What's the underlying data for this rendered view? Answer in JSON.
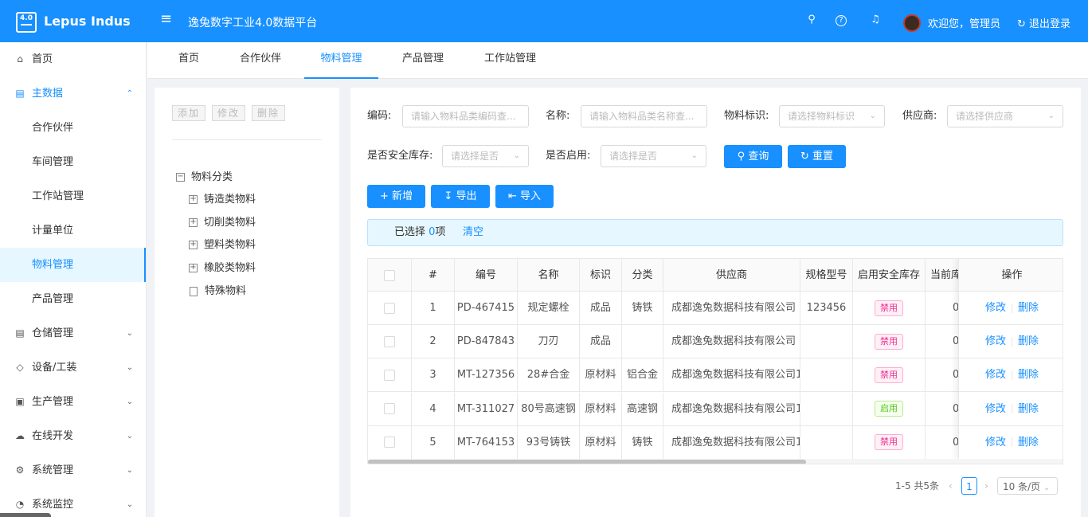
{
  "app": {
    "logo_badge": "4.0",
    "name": "Lepus Indus",
    "system_title": "逸兔数字工业4.0数据平台"
  },
  "topbar": {
    "welcome": "欢迎您，管理员",
    "logout": "退出登录"
  },
  "sidebar": {
    "items": [
      {
        "label": "首页",
        "icon": "home-icon"
      },
      {
        "label": "主数据",
        "icon": "list-icon",
        "expanded": true
      },
      {
        "label": "合作伙伴"
      },
      {
        "label": "车间管理"
      },
      {
        "label": "工作站管理"
      },
      {
        "label": "计量单位"
      },
      {
        "label": "物料管理",
        "active": true
      },
      {
        "label": "产品管理"
      },
      {
        "label": "仓储管理",
        "icon": "warehouse-icon"
      },
      {
        "label": "设备/工装",
        "icon": "tag-icon"
      },
      {
        "label": "生产管理",
        "icon": "document-icon"
      },
      {
        "label": "在线开发",
        "icon": "cloud-icon"
      },
      {
        "label": "系统管理",
        "icon": "gear-icon"
      },
      {
        "label": "系统监控",
        "icon": "dashboard-icon"
      }
    ]
  },
  "tabs": [
    "首页",
    "合作伙伴",
    "物料管理",
    "产品管理",
    "工作站管理"
  ],
  "active_tab": "物料管理",
  "tree": {
    "buttons": {
      "add": "添加",
      "edit": "修改",
      "delete": "删除"
    },
    "root": "物料分类",
    "children": [
      "铸造类物料",
      "切削类物料",
      "塑料类物料",
      "橡胶类物料",
      "特殊物料"
    ]
  },
  "filters": {
    "code_label": "编码:",
    "code_placeholder": "请输入物料品类编码查...",
    "name_label": "名称:",
    "name_placeholder": "请输入物料品类名称查...",
    "mark_label": "物料标识:",
    "mark_placeholder": "请选择物料标识",
    "supplier_label": "供应商:",
    "supplier_placeholder": "请选择供应商",
    "safety_label": "是否安全库存:",
    "safety_placeholder": "请选择是否",
    "enabled_label": "是否启用:",
    "enabled_placeholder": "请选择是否",
    "query": "查询",
    "reset": "重置"
  },
  "actions": {
    "add": "新增",
    "export": "导出",
    "import": "导入"
  },
  "selection": {
    "prefix": "已选择 ",
    "count": "0",
    "suffix": "项",
    "clear": "清空"
  },
  "table": {
    "headers": [
      "#",
      "编号",
      "名称",
      "标识",
      "分类",
      "供应商",
      "规格型号",
      "启用安全库存",
      "当前库存",
      "操作"
    ],
    "rows": [
      {
        "no": "1",
        "code": "PD-467415",
        "name": "规定螺栓",
        "mark": "成品",
        "category": "铸铁",
        "supplier": "成都逸兔数据科技有限公司",
        "spec": "123456",
        "safety": "禁用",
        "safety_on": false,
        "stock": "0"
      },
      {
        "no": "2",
        "code": "PD-847843",
        "name": "刀刃",
        "mark": "成品",
        "category": "",
        "supplier": "成都逸兔数据科技有限公司",
        "spec": "",
        "safety": "禁用",
        "safety_on": false,
        "stock": "0"
      },
      {
        "no": "3",
        "code": "MT-127356",
        "name": "28#合金",
        "mark": "原材料",
        "category": "铝合金",
        "supplier": "成都逸兔数据科技有限公司1",
        "spec": "",
        "safety": "禁用",
        "safety_on": false,
        "stock": "0"
      },
      {
        "no": "4",
        "code": "MT-311027",
        "name": "80号高速钢",
        "mark": "原材料",
        "category": "高速钢",
        "supplier": "成都逸兔数据科技有限公司1",
        "spec": "",
        "safety": "启用",
        "safety_on": true,
        "stock": "0"
      },
      {
        "no": "5",
        "code": "MT-764153",
        "name": "93号铸铁",
        "mark": "原材料",
        "category": "铸铁",
        "supplier": "成都逸兔数据科技有限公司1",
        "spec": "",
        "safety": "禁用",
        "safety_on": false,
        "stock": "0"
      }
    ],
    "edit": "修改",
    "delete": "删除"
  },
  "pagination": {
    "total": "1-5 共5条",
    "current": "1",
    "size": "10 条/页"
  },
  "colors": {
    "primary": "#1890ff",
    "disabled_tag": "#eb2f96",
    "enabled_tag": "#52c41a"
  }
}
